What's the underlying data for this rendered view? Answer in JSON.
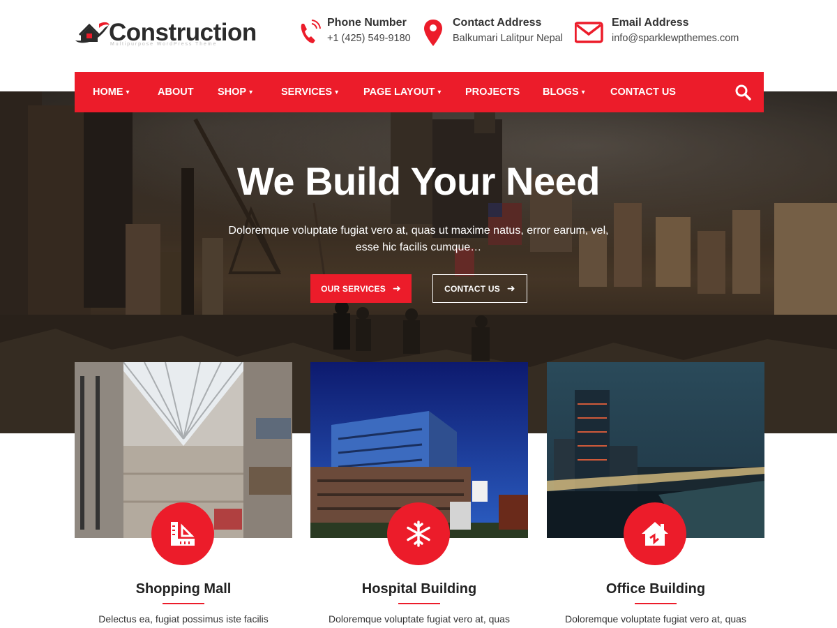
{
  "brand": {
    "name": "Construction",
    "tagline": "Multipurpose WordPress Theme"
  },
  "contact_info": [
    {
      "icon": "phone-icon",
      "title": "Phone Number",
      "value": "+1 (425) 549-9180"
    },
    {
      "icon": "location-pin-icon",
      "title": "Contact Address",
      "value": "Balkumari Lalitpur Nepal"
    },
    {
      "icon": "envelope-icon",
      "title": "Email Address",
      "value": "info@sparklewpthemes.com"
    }
  ],
  "nav": {
    "items": [
      {
        "label": "HOME",
        "has_dropdown": true
      },
      {
        "label": "ABOUT",
        "has_dropdown": false
      },
      {
        "label": "SHOP",
        "has_dropdown": true
      },
      {
        "label": "SERVICES",
        "has_dropdown": true
      },
      {
        "label": "PAGE LAYOUT",
        "has_dropdown": true
      },
      {
        "label": "PROJECTS",
        "has_dropdown": false
      },
      {
        "label": "BLOGS",
        "has_dropdown": true
      },
      {
        "label": "CONTACT US",
        "has_dropdown": false
      }
    ],
    "search_icon": "search-icon"
  },
  "hero": {
    "title": "We Build Your Need",
    "text": "Doloremque voluptate fugiat vero at, quas ut maxime natus, error earum, vel, esse hic facilis cumque…",
    "primary_button": "OUR SERVICES",
    "secondary_button": "CONTACT US"
  },
  "services": [
    {
      "title": "Shopping Mall",
      "icon": "ruler-square-icon",
      "description": "Delectus ea, fugiat possimus iste facilis"
    },
    {
      "title": "Hospital Building",
      "icon": "snowflake-icon",
      "description": "Doloremque voluptate fugiat vero at, quas"
    },
    {
      "title": "Office Building",
      "icon": "house-icon",
      "description": "Doloremque voluptate fugiat vero at, quas"
    }
  ],
  "colors": {
    "accent": "#ec1c2a",
    "heading": "#222222",
    "white": "#ffffff"
  }
}
